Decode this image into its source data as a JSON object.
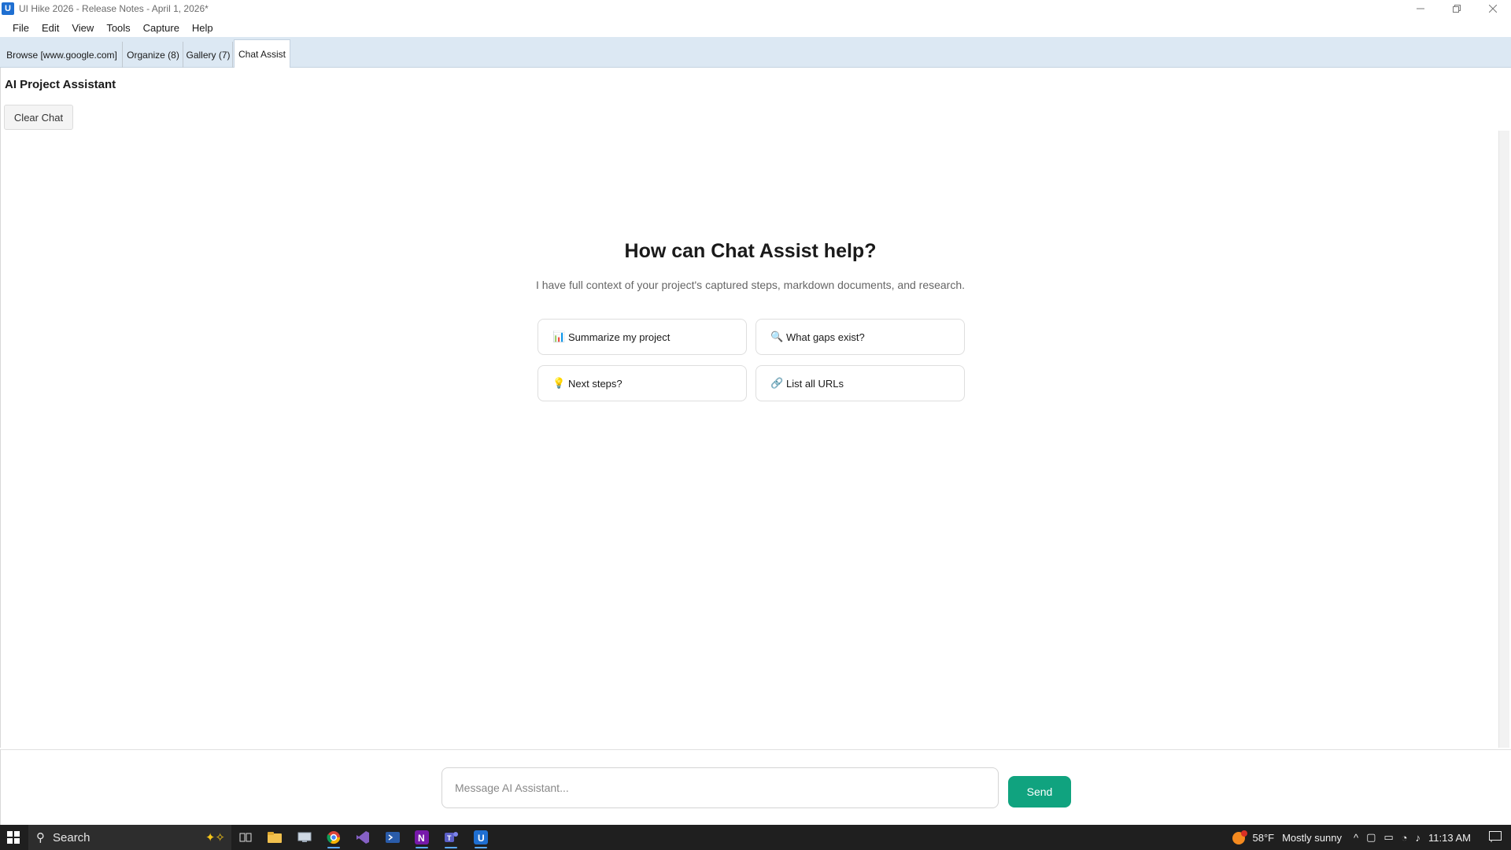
{
  "window": {
    "title": "UI Hike 2026 - Release Notes - April 1, 2026*",
    "app_icon_letter": "U"
  },
  "menu": [
    "File",
    "Edit",
    "View",
    "Tools",
    "Capture",
    "Help"
  ],
  "tabs": [
    {
      "label": "Browse [www.google.com]",
      "active": false
    },
    {
      "label": "Organize (8)",
      "active": false
    },
    {
      "label": "Gallery (7)",
      "active": false
    },
    {
      "label": "Chat Assist",
      "active": true
    }
  ],
  "panel": {
    "title": "AI Project Assistant",
    "clear_label": "Clear Chat"
  },
  "welcome": {
    "title": "How can Chat Assist help?",
    "subtitle": "I have full context of your project's captured steps, markdown documents, and research."
  },
  "suggestions": [
    {
      "icon": "bar-chart-icon",
      "glyph": "📊",
      "label": "Summarize my project"
    },
    {
      "icon": "magnifier-icon",
      "glyph": "🔍",
      "label": "What gaps exist?"
    },
    {
      "icon": "lightbulb-icon",
      "glyph": "💡",
      "label": "Next steps?"
    },
    {
      "icon": "link-icon",
      "glyph": "🔗",
      "label": "List all URLs"
    }
  ],
  "composer": {
    "placeholder": "Message AI Assistant...",
    "value": "",
    "send_label": "Send"
  },
  "taskbar": {
    "search_label": "Search",
    "weather_temp": "58°F",
    "weather_text": "Mostly sunny",
    "weather_badge": "1",
    "time": "11:13 AM"
  },
  "colors": {
    "accent": "#10a37f",
    "tabbar": "#dce8f3",
    "taskbar": "#1f1f1f"
  }
}
